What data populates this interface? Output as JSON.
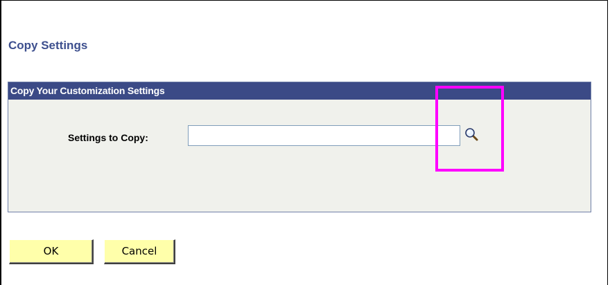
{
  "page": {
    "title": "Copy Settings"
  },
  "group": {
    "header": "Copy Your Customization Settings"
  },
  "field": {
    "label": "Settings to Copy:",
    "value": "",
    "placeholder": ""
  },
  "icons": {
    "lookup": "magnifier-lookup-icon"
  },
  "buttons": {
    "ok_label": "OK",
    "cancel_label": "Cancel"
  },
  "colors": {
    "title": "#3d4f8e",
    "header_bg": "#3b4a86",
    "group_bg": "#f0f1ec",
    "button_bg": "#ffffaa",
    "highlight": "#ff00ff"
  }
}
